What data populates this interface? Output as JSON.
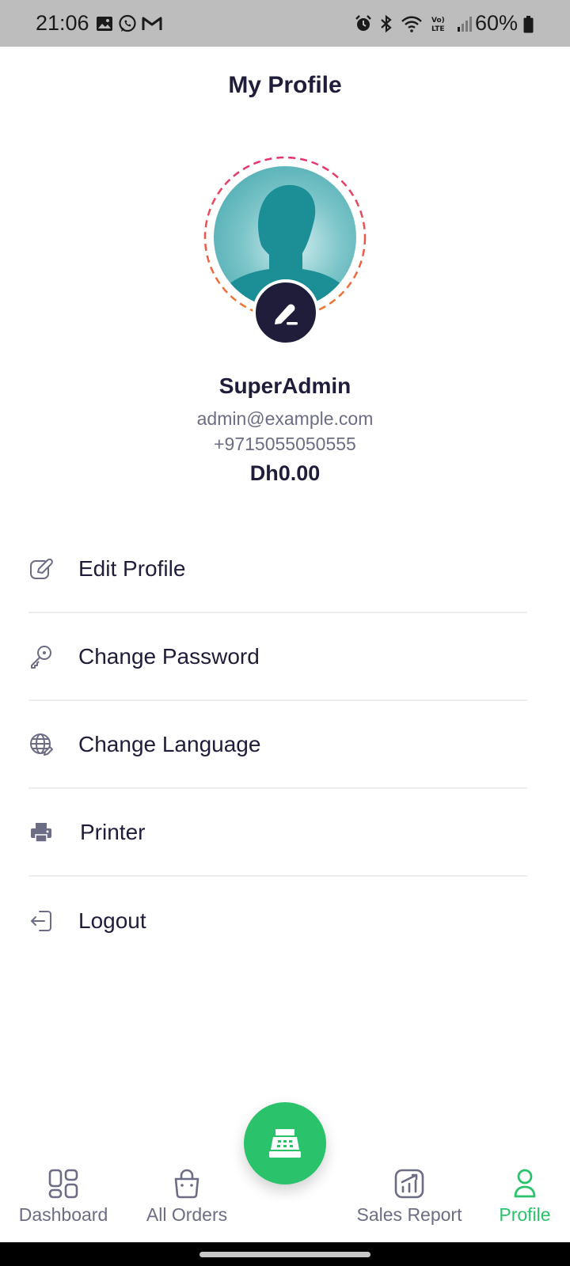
{
  "status_bar": {
    "time": "21:06",
    "battery": "60%",
    "left_icons": [
      "image-icon",
      "whatsapp-icon",
      "gmail-icon"
    ],
    "right_icons": [
      "alarm-icon",
      "bluetooth-icon",
      "wifi-icon",
      "volte-icon",
      "signal-icon",
      "battery-icon"
    ]
  },
  "header": {
    "title": "My Profile"
  },
  "profile": {
    "name": "SuperAdmin",
    "email": "admin@example.com",
    "phone": "+9715055050555",
    "balance": "Dh0.00"
  },
  "menu": {
    "items": [
      {
        "label": "Edit Profile",
        "icon": "edit-icon"
      },
      {
        "label": "Change Password",
        "icon": "key-icon"
      },
      {
        "label": "Change Language",
        "icon": "globe-icon"
      },
      {
        "label": "Printer",
        "icon": "printer-icon"
      },
      {
        "label": "Logout",
        "icon": "logout-icon"
      }
    ]
  },
  "bottom_nav": {
    "items": [
      {
        "label": "Dashboard",
        "icon": "dashboard-icon",
        "active": false
      },
      {
        "label": "All Orders",
        "icon": "shopping-bag-icon",
        "active": false
      },
      {
        "label": "Sales Report",
        "icon": "sales-chart-icon",
        "active": false
      },
      {
        "label": "Profile",
        "icon": "user-icon",
        "active": true
      }
    ],
    "center_button_icon": "cash-register-icon"
  },
  "colors": {
    "primary_dark": "#1f1d3a",
    "accent_green": "#2ac36b",
    "muted_text": "#6c6d84",
    "ring_pink": "#e6336f",
    "ring_orange": "#f07a2c"
  }
}
